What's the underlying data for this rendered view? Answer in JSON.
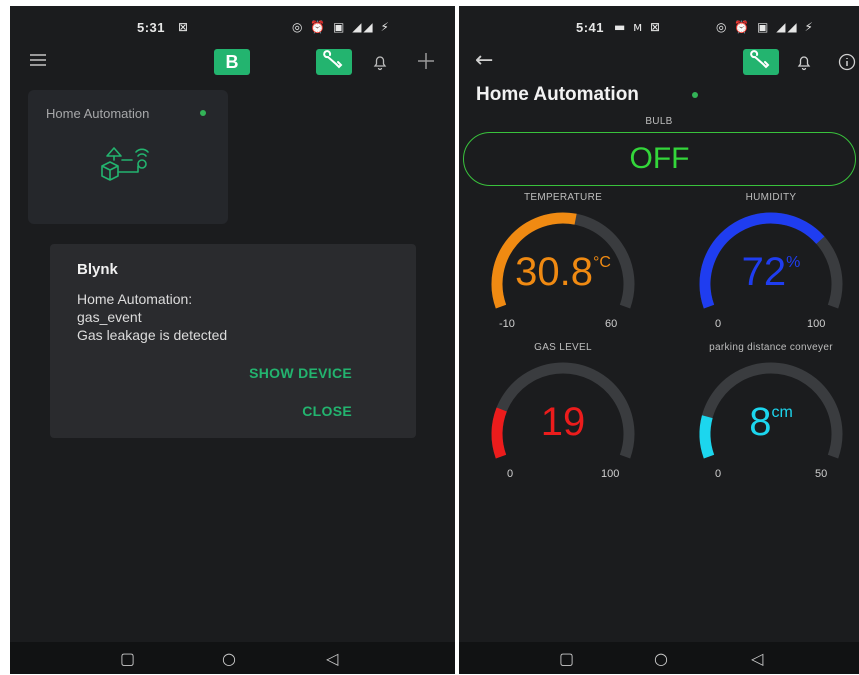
{
  "left_screen": {
    "status": {
      "time": "5:31",
      "left_icons": "⊠",
      "right_icons": "◎ ⏰ ▣ ◢◢ ⚡"
    },
    "appbar": {
      "logo_letter": "B"
    },
    "device_tile": {
      "title": "Home Automation",
      "status_color": "#33b357"
    },
    "dialog": {
      "title": "Blynk",
      "lines": [
        "Home Automation:",
        "gas_event",
        "Gas leakage is detected"
      ],
      "show_device": "SHOW DEVICE",
      "close": "CLOSE"
    }
  },
  "right_screen": {
    "status": {
      "time": "5:41",
      "left_icons": "▬ ᴍ ⊠",
      "right_icons": "◎ ⏰ ▣ ◢◢ ⚡"
    },
    "title": "Home Automation",
    "bulb": {
      "label": "BULB",
      "value": "OFF"
    },
    "gauges": [
      {
        "key": "temperature",
        "label": "TEMPERATURE",
        "value": "30.8",
        "unit": "°C",
        "min": "-10",
        "max": "60",
        "fraction": 0.55,
        "color": "#f08a12"
      },
      {
        "key": "humidity",
        "label": "HUMIDITY",
        "value": "72",
        "unit": "%",
        "min": "0",
        "max": "100",
        "fraction": 0.72,
        "color": "#1f3df0"
      },
      {
        "key": "gas",
        "label": "GAS LEVEL",
        "value": "19",
        "unit": "",
        "min": "0",
        "max": "100",
        "fraction": 0.19,
        "color": "#ec1c1c"
      },
      {
        "key": "parking",
        "label": "parking distance conveyer",
        "value": "8",
        "unit": "cm",
        "min": "0",
        "max": "50",
        "fraction": 0.16,
        "color": "#1cd6ee"
      }
    ]
  },
  "colors": {
    "accent": "#23b46f",
    "background": "#1b1c1e",
    "track": "#3a3c3f"
  }
}
